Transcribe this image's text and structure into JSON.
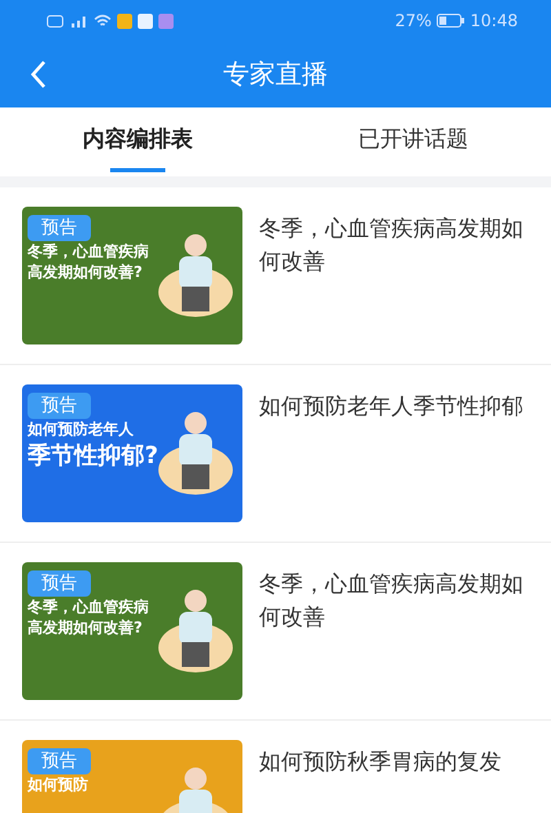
{
  "status_bar": {
    "battery_text": "27%",
    "time": "10:48"
  },
  "header": {
    "title": "专家直播"
  },
  "tabs": [
    {
      "label": "内容编排表",
      "selected": true
    },
    {
      "label": "已开讲话题",
      "selected": false
    }
  ],
  "items": [
    {
      "title": "冬季，心血管疾病高发期如何改善",
      "thumb": {
        "badge": "预告",
        "lines": [
          "冬季，心血管疾病",
          "高发期如何改善?"
        ],
        "color": "#4a7d2a"
      }
    },
    {
      "title": "如何预防老年人季节性抑郁",
      "thumb": {
        "badge": "预告",
        "lines": [
          "如何预防老年人",
          "季节性抑郁?"
        ],
        "color": "#1f6ee6"
      }
    },
    {
      "title": "冬季，心血管疾病高发期如何改善",
      "thumb": {
        "badge": "预告",
        "lines": [
          "冬季，心血管疾病",
          "高发期如何改善?"
        ],
        "color": "#4a7d2a"
      }
    },
    {
      "title": "如何预防秋季胃病的复发",
      "thumb": {
        "badge": "预告",
        "lines": [
          "如何预防"
        ],
        "color": "#e8a21c"
      }
    }
  ]
}
